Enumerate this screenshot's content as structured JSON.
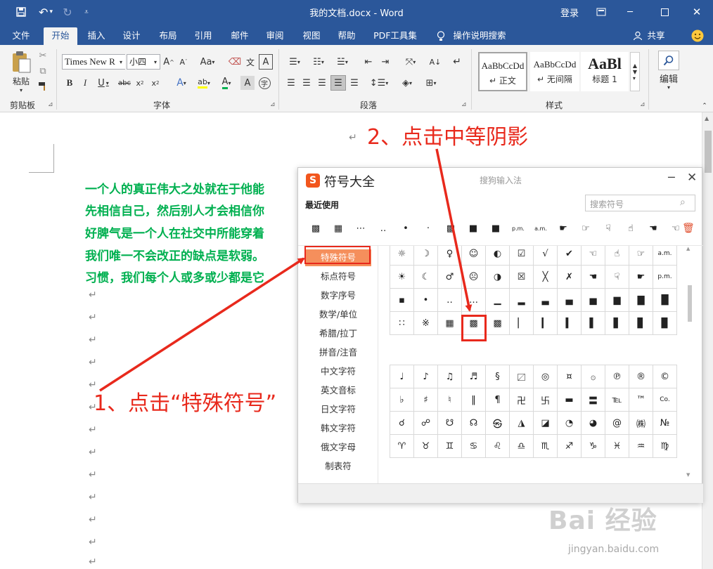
{
  "window": {
    "title": "我的文档.docx - Word",
    "signin": "登录"
  },
  "tabs": [
    "文件",
    "开始",
    "插入",
    "设计",
    "布局",
    "引用",
    "邮件",
    "审阅",
    "视图",
    "帮助",
    "PDF工具集"
  ],
  "tell_me": "操作说明搜索",
  "share": "共享",
  "ribbon": {
    "clipboard": {
      "paste": "粘贴",
      "label": "剪贴板"
    },
    "font": {
      "name": "Times New R",
      "size": "小四",
      "label": "字体",
      "aa": "Aa",
      "wen": "文",
      "a_char": "A",
      "zi": "字"
    },
    "paragraph": {
      "label": "段落"
    },
    "styles": {
      "label": "样式",
      "items": [
        {
          "sample": "AaBbCcDd",
          "name": "正文"
        },
        {
          "sample": "AaBbCcDd",
          "name": "无间隔"
        },
        {
          "sample": "AaBl",
          "name": "标题 1"
        }
      ]
    },
    "editing": {
      "label": "编辑"
    }
  },
  "document": {
    "lines": [
      "一个人的真正伟大之处就在于他能",
      "先相信自己，然后别人才会相信你",
      "好脾气是一个人在社交中所能穿着",
      "我们唯一不会改正的缺点是软弱。",
      "习惯，我们每个人或多或少都是它"
    ],
    "para_mark": "↵"
  },
  "dialog": {
    "title": "符号大全",
    "subtitle": "搜狗输入法",
    "recent_label": "最近使用",
    "search_placeholder": "搜索符号",
    "recent": [
      "▩",
      "▦",
      "⋯",
      "‥",
      "•",
      "·",
      "▩",
      "■",
      "■",
      "p.m.",
      "a.m.",
      "☛",
      "☞",
      "☟",
      "☝",
      "☚",
      "☜"
    ],
    "categories": [
      "特殊符号",
      "标点符号",
      "数字序号",
      "数学/单位",
      "希腊/拉丁",
      "拼音/注音",
      "中文字符",
      "英文音标",
      "日文字符",
      "韩文字符",
      "俄文字母",
      "制表符"
    ],
    "grid_top": [
      [
        "☼",
        "☽",
        "♀",
        "☺",
        "◐",
        "☑",
        "√",
        "✔",
        "☜",
        "☝",
        "☞",
        "a.m."
      ],
      [
        "☀",
        "☾",
        "♂",
        "☹",
        "◑",
        "☒",
        "╳",
        "✗",
        "☚",
        "☟",
        "☛",
        "p.m."
      ],
      [
        "▪",
        "•",
        "‥",
        "…",
        "▁",
        "▂",
        "▃",
        "▄",
        "▅",
        "▆",
        "▇",
        "█"
      ],
      [
        "∷",
        "※",
        "▦",
        "▩",
        "▩",
        "▏",
        "▎",
        "▍",
        "▌",
        "▋",
        "▊",
        "▉"
      ]
    ],
    "grid_bottom": [
      [
        "♩",
        "♪",
        "♫",
        "♬",
        "§",
        "〼",
        "◎",
        "¤",
        "۞",
        "℗",
        "®",
        "©"
      ],
      [
        "♭",
        "♯",
        "♮",
        "‖",
        "¶",
        "卍",
        "卐",
        "▬",
        "〓",
        "℡",
        "™",
        "Co."
      ],
      [
        "☌",
        "☍",
        "☋",
        "☊",
        "㉿",
        "◮",
        "◪",
        "◔",
        "◕",
        "@",
        "㈱",
        "№"
      ],
      [
        "♈",
        "♉",
        "♊",
        "♋",
        "♌",
        "♎",
        "♏",
        "♐",
        "♑",
        "♓",
        "♒",
        "♍"
      ]
    ]
  },
  "annotations": {
    "step1": "1、点击“特殊符号”",
    "step2": "2、点击中等阴影",
    "color": "#e8291c"
  },
  "watermark": {
    "main": "Bai 经验",
    "sub": "jingyan.baidu.com"
  },
  "colors": {
    "word_blue": "#2b579a",
    "doc_text": "#00b050",
    "sogou_orange": "#f58f5c"
  }
}
